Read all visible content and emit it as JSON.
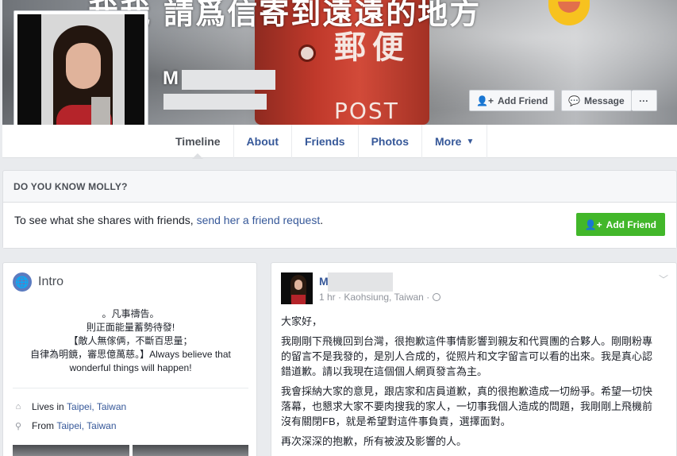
{
  "cover": {
    "caption": "我我 請爲信寄到遠遠的地方",
    "postbox_chars": [
      "郵",
      "便"
    ],
    "postbox_word": "POST",
    "profile_name": "M      g"
  },
  "actions": {
    "add_friend": "Add Friend",
    "message": "Message",
    "more": "···"
  },
  "tabs": [
    {
      "label": "Timeline",
      "active": true
    },
    {
      "label": "About"
    },
    {
      "label": "Friends"
    },
    {
      "label": "Photos"
    },
    {
      "label": "More",
      "caret": "▼"
    }
  ],
  "know": {
    "heading": "DO YOU KNOW MOLLY?",
    "text": "To see what she shares with friends, ",
    "link": "send her a friend request",
    "end": ".",
    "button": "Add Friend"
  },
  "intro": {
    "title": "Intro",
    "bio": [
      "。凡事禱告。",
      "則正面能量蓄勢待發!",
      "【敵人無傢俩，不斷百思量；",
      "自律為明鏡，審思億萬慈。】Always believe that wonderful things will happen!"
    ],
    "lives_prefix": "Lives in ",
    "lives_link": "Taipei, Taiwan",
    "from_prefix": "From ",
    "from_link": "Taipei, Taiwan"
  },
  "post": {
    "author_initial": "M",
    "meta": "1 hr · Kaohsiung, Taiwan · ",
    "paragraphs": [
      "大家好，",
      "我剛剛下飛機回到台灣，很抱歉這件事情影響到親友和代買團的合夥人。剛剛粉專的留言不是我發的，是別人合成的，從照片和文字留言可以看的出來。我是真心認錯道歉。請以我現在這個個人網頁發言為主。",
      "我會採納大家的意見，跟店家和店員道歉，真的很抱歉造成一切紛爭。希望一切快落幕，也懇求大家不要肉搜我的家人，一切事我個人造成的問題，我剛剛上飛機前沒有關閉FB，就是希望對這件事負責，選擇面對。",
      "再次深深的抱歉，所有被波及影響的人。"
    ]
  }
}
